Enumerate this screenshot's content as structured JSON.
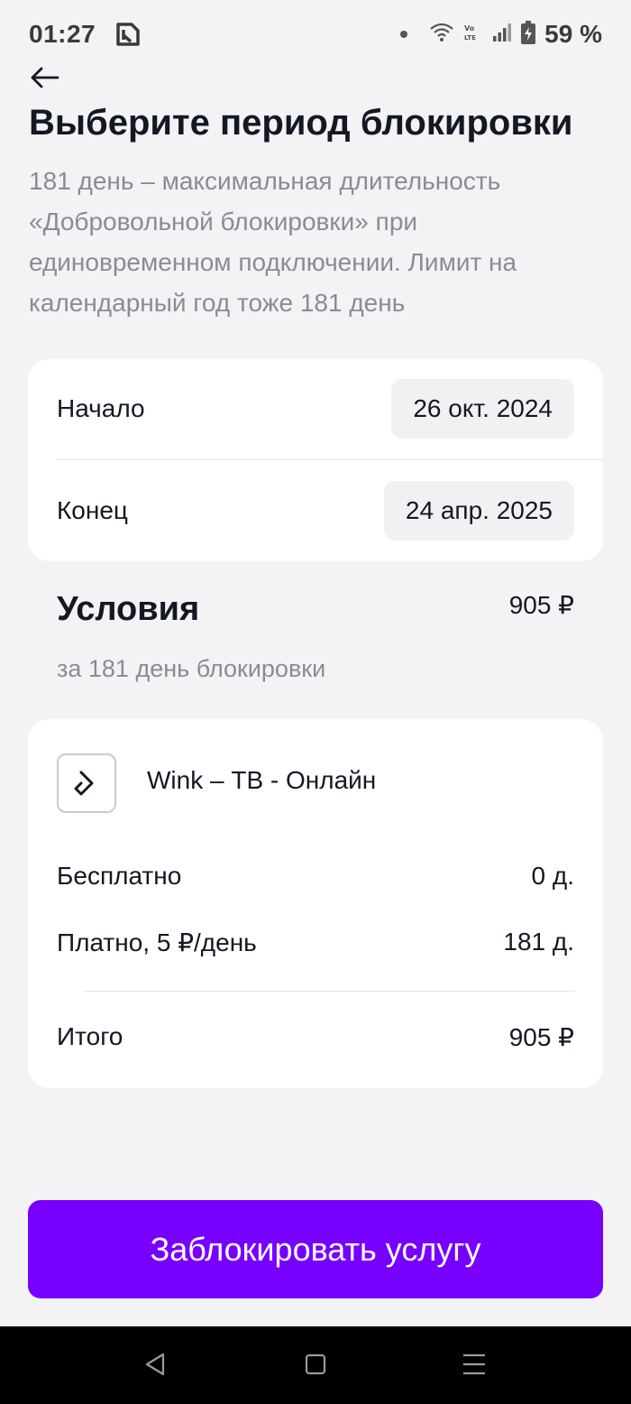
{
  "status_bar": {
    "time": "01:27",
    "battery": "59 %",
    "icons": [
      "app-k-logo-icon",
      "dot-icon",
      "wifi-icon",
      "volte-icon",
      "signal-icon",
      "battery-charging-icon"
    ]
  },
  "header": {
    "title": "Выберите период блокировки",
    "description": "181 день – максимальная длительность «Добровольной блокировки» при единовременном подключении. Лимит на календарный год тоже 181 день"
  },
  "dates": {
    "start_label": "Начало",
    "start_value": "26 окт. 2024",
    "end_label": "Конец",
    "end_value": "24 апр. 2025"
  },
  "conditions": {
    "title": "Условия",
    "price": "905 ₽",
    "subtitle": "за 181 день блокировки"
  },
  "details": {
    "service_name": "Wink – ТВ - Онлайн",
    "free_label": "Бесплатно",
    "free_value": "0 д.",
    "paid_label": "Платно, 5 ₽/день",
    "paid_value": "181 д.",
    "total_label": "Итого",
    "total_value": "905 ₽"
  },
  "action": {
    "button_label": "Заблокировать услугу"
  },
  "colors": {
    "accent": "#7700ff",
    "background": "#f3f3f5",
    "card": "#ffffff",
    "muted_text": "#8a8c94"
  }
}
